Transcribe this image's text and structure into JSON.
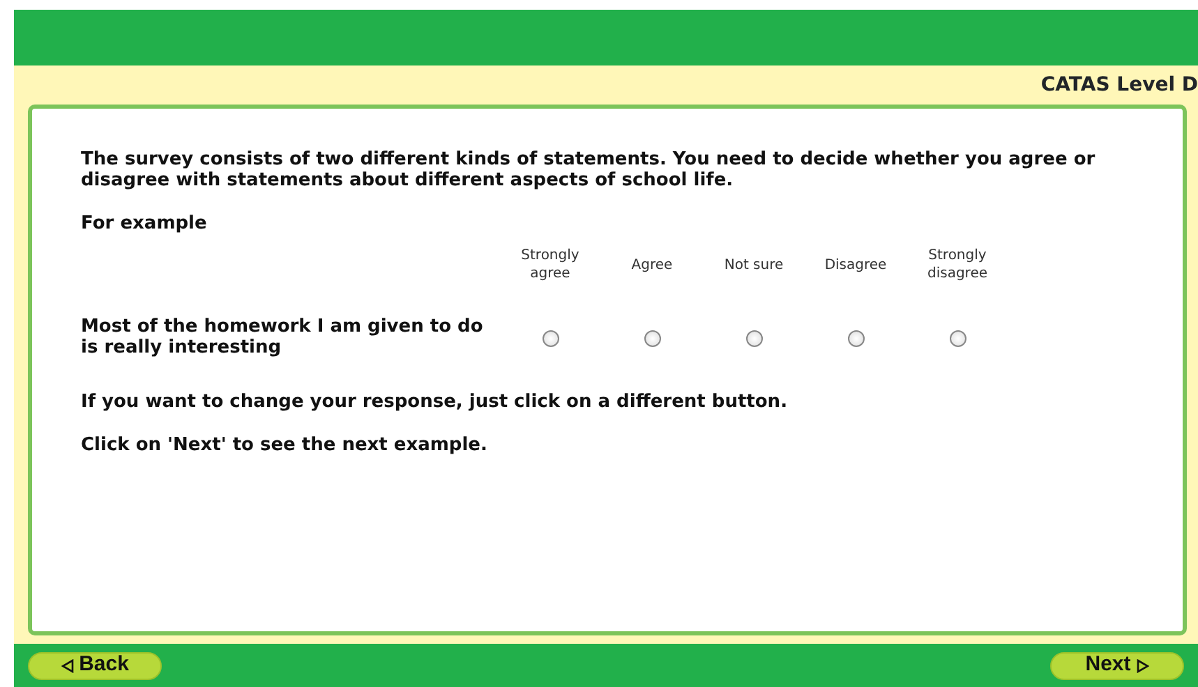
{
  "header": {
    "title": "CATAS Level D"
  },
  "intro": "The survey consists of two different kinds of statements.  You need to decide whether you agree or disagree with statements about different aspects of school life.",
  "example_label": "For example",
  "scale": [
    {
      "label": "Strongly agree"
    },
    {
      "label": "Agree"
    },
    {
      "label": "Not sure"
    },
    {
      "label": "Disagree"
    },
    {
      "label": "Strongly disagree"
    }
  ],
  "statement": {
    "text": "Most of the homework I am given to do is really interesting",
    "options": [
      {
        "selected": false
      },
      {
        "selected": false
      },
      {
        "selected": false
      },
      {
        "selected": false
      },
      {
        "selected": false
      }
    ]
  },
  "notes": [
    "If you want to change your response, just click on a different button.",
    "Click on 'Next' to see the next example."
  ],
  "nav": {
    "back": "Back",
    "next": "Next"
  }
}
